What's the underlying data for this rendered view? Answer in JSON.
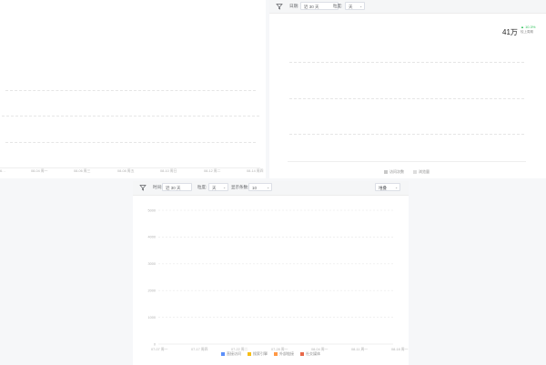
{
  "top_left_chart": {
    "x_ticks": [
      "6…",
      "08-04 周一",
      "08-06 周三",
      "08-08 周五",
      "08-10 周日",
      "08-12 周二",
      "08-14 周四"
    ]
  },
  "top_right_panel": {
    "toolbar": {
      "range_label": "日期:",
      "range_value": "近 30 天",
      "granularity_label": "粒度:",
      "granularity_value": "天"
    },
    "kpi_value": "41万",
    "kpi_change": "▲ 10.3%",
    "kpi_compare_label": "较上周期",
    "legend": [
      {
        "label": "访问次数",
        "color": "#c8c8c8"
      },
      {
        "label": "浏览量",
        "color": "#dddddd"
      }
    ]
  },
  "bottom_panel": {
    "toolbar": {
      "time_label": "时间:",
      "time_value": "近 30 天",
      "granularity_label": "粒度:",
      "granularity_value": "天",
      "topn_label": "显示条数:",
      "topn_value": "10",
      "view_value": "堆叠"
    },
    "chart_data": {
      "type": "line",
      "ylim": [
        0,
        5000
      ],
      "y_ticks": [
        "5000",
        "4000",
        "3000",
        "2000",
        "1000",
        "0"
      ],
      "x_ticks": [
        "07-07 周一",
        "07-17 周四",
        "07-22 周二",
        "07-28 周一",
        "08-04 周一",
        "08-11 周一",
        "08-18 周一"
      ],
      "series": [
        {
          "name": "直接访问",
          "color": "#5b8ff9"
        },
        {
          "name": "搜索引擎",
          "color": "#f6bd16"
        },
        {
          "name": "外部链接",
          "color": "#ff9845"
        },
        {
          "name": "社交媒体",
          "color": "#e8684a"
        }
      ]
    }
  }
}
